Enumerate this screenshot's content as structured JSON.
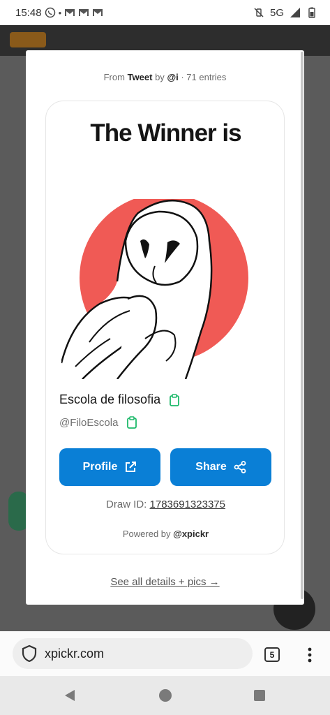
{
  "status_bar": {
    "time": "15:48",
    "network": "5G"
  },
  "modal": {
    "source": {
      "prefix": "From",
      "platform": "Tweet",
      "by": "by",
      "author": "@i",
      "entries": "· 71 entries"
    },
    "card": {
      "title": "The Winner is",
      "winner_name": "Escola de filosofia",
      "winner_handle": "@FiloEscola",
      "profile_label": "Profile",
      "share_label": "Share",
      "draw_id_label": "Draw ID:",
      "draw_id": "1783691323375",
      "powered_prefix": "Powered by",
      "powered_brand": "@xpickr"
    },
    "see_all_label": "See all details + pics →"
  },
  "browser": {
    "url": "xpickr.com",
    "tab_count": "5"
  },
  "colors": {
    "button_blue": "#0a7fd6",
    "copy_green": "#1db96a",
    "avatar_circle": "#f05a55"
  }
}
